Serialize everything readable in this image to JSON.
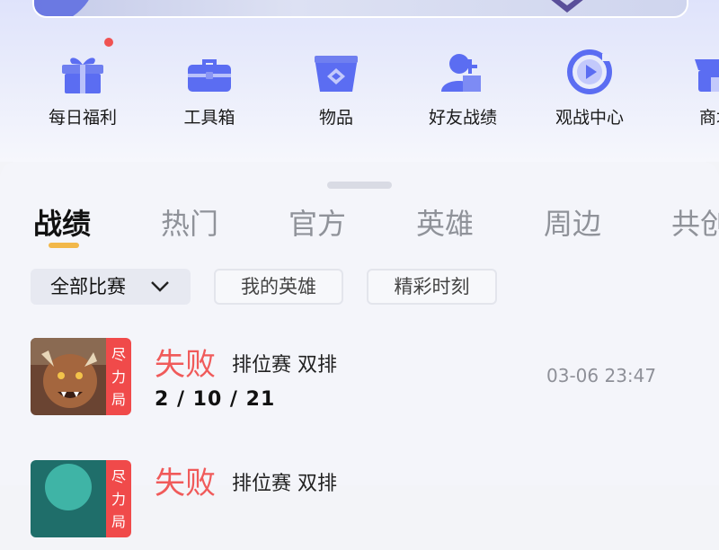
{
  "quick_access": [
    {
      "label": "每日福利",
      "icon": "gift-icon",
      "has_dot": true
    },
    {
      "label": "工具箱",
      "icon": "toolbox-icon",
      "has_dot": false
    },
    {
      "label": "物品",
      "icon": "items-icon",
      "has_dot": false
    },
    {
      "label": "好友战绩",
      "icon": "friend-record-icon",
      "has_dot": false
    },
    {
      "label": "观战中心",
      "icon": "spectate-icon",
      "has_dot": false
    },
    {
      "label": "商城",
      "icon": "shop-icon",
      "has_dot": false
    }
  ],
  "tabs": [
    {
      "label": "战绩",
      "active": true
    },
    {
      "label": "热门",
      "active": false
    },
    {
      "label": "官方",
      "active": false
    },
    {
      "label": "英雄",
      "active": false
    },
    {
      "label": "周边",
      "active": false
    },
    {
      "label": "共创",
      "active": false
    }
  ],
  "filters": {
    "all_matches": "全部比赛",
    "my_heroes": "我的英雄",
    "highlights": "精彩时刻"
  },
  "matches": [
    {
      "result": "失败",
      "mode": "排位赛 双排",
      "kda": "2 / 10 / 21",
      "time": "03-06 23:47",
      "badge": [
        "尽",
        "力",
        "局"
      ]
    },
    {
      "result": "失败",
      "mode": "排位赛 双排",
      "kda": "",
      "time": "",
      "badge": [
        "尽",
        "力",
        "局"
      ]
    }
  ],
  "colors": {
    "accent_blue": "#5b6df2",
    "loss_red": "#f05a5a",
    "tab_underline": "#f2b84a"
  }
}
